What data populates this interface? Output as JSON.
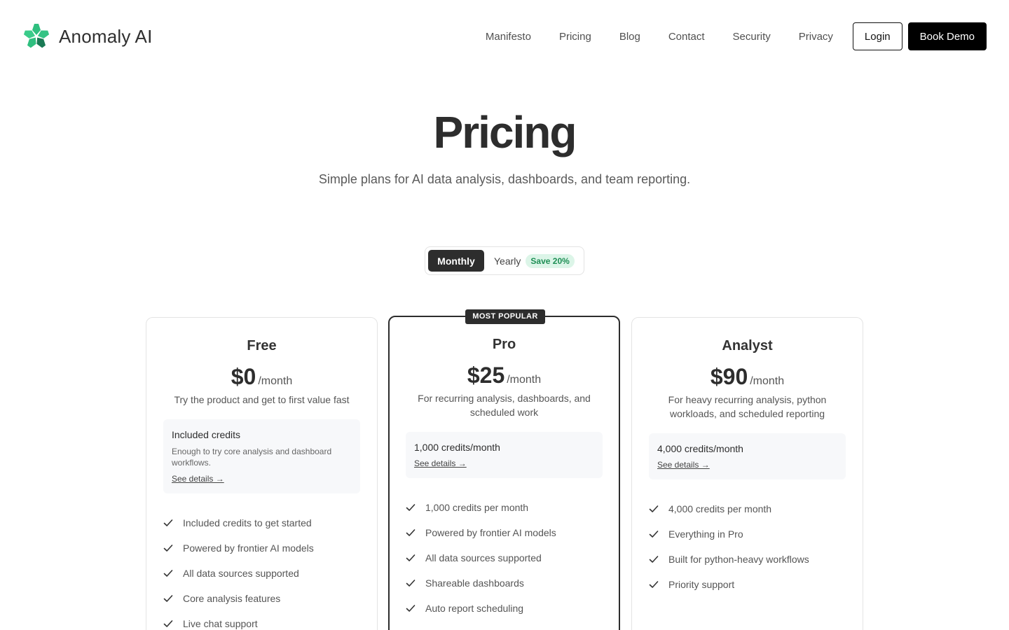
{
  "header": {
    "brand_name": "Anomaly AI",
    "nav": [
      "Manifesto",
      "Pricing",
      "Blog",
      "Contact",
      "Security",
      "Privacy"
    ],
    "login_label": "Login",
    "demo_label": "Book Demo"
  },
  "hero": {
    "title": "Pricing",
    "subtitle": "Simple plans for AI data analysis, dashboards, and team reporting."
  },
  "billing": {
    "monthly_label": "Monthly",
    "yearly_label": "Yearly",
    "save_badge": "Save 20%",
    "selected": "Monthly"
  },
  "plans": [
    {
      "name": "Free",
      "price": "$0",
      "period": "/month",
      "description": "Try the product and get to first value fast",
      "credits_title": "Included credits",
      "credits_note": "Enough to try core analysis and dashboard workflows.",
      "details_link": "See details →",
      "features": [
        "Included credits to get started",
        "Powered by frontier AI models",
        "All data sources supported",
        "Core analysis features",
        "Live chat support"
      ]
    },
    {
      "name": "Pro",
      "badge": "MOST POPULAR",
      "price": "$25",
      "period": "/month",
      "description": "For recurring analysis, dashboards, and scheduled work",
      "credits_title": "1,000 credits/month",
      "details_link": "See details →",
      "features": [
        "1,000 credits per month",
        "Powered by frontier AI models",
        "All data sources supported",
        "Shareable dashboards",
        "Auto report scheduling"
      ]
    },
    {
      "name": "Analyst",
      "price": "$90",
      "period": "/month",
      "description": "For heavy recurring analysis, python workloads, and scheduled reporting",
      "credits_title": "4,000 credits/month",
      "details_link": "See details →",
      "features": [
        "4,000 credits per month",
        "Everything in Pro",
        "Built for python-heavy workflows",
        "Priority support"
      ]
    }
  ],
  "colors": {
    "brand_green": "#2fbf7f",
    "brand_dark_green": "#1a7a55",
    "dark": "#2d2d2d",
    "save_badge_bg": "#dcf5e8",
    "save_badge_text": "#1e8f55"
  },
  "icons": {
    "logo": "clover-logo-icon",
    "feature": "check-icon"
  }
}
